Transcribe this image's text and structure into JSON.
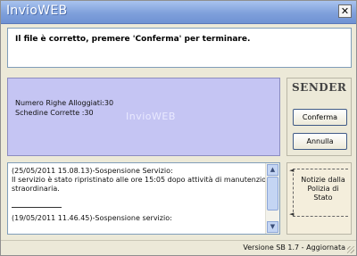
{
  "window": {
    "title": "InvioWEB",
    "close_glyph": "✕"
  },
  "message": "Il file è corretto, premere 'Conferma' per terminare.",
  "info": {
    "lines": [
      "Numero Righe Alloggiati:30",
      "Schedine Corrette :30"
    ],
    "watermark": "InvioWEB",
    "background_color": "#c5c5f3"
  },
  "sender": {
    "logo": "SENDER",
    "confirm_label": "Conferma",
    "cancel_label": "Annulla"
  },
  "log": {
    "entries": [
      {
        "header": "(25/05/2011 15.08.13)-Sospensione Servizio:",
        "body_line1": "Il servizio è stato ripristinato alle ore 15:05 dopo attività di manutenzione",
        "body_line2": "straordinaria."
      },
      {
        "header": "(19/05/2011 11.46.45)-Sospensione servizio:"
      }
    ]
  },
  "news": {
    "label_line1": "Notizie dalla",
    "label_line2": "Polizia di Stato",
    "arrow_icon": "chevron-left-icon"
  },
  "status": {
    "version": "Versione SB 1.7 - Aggiornata"
  }
}
